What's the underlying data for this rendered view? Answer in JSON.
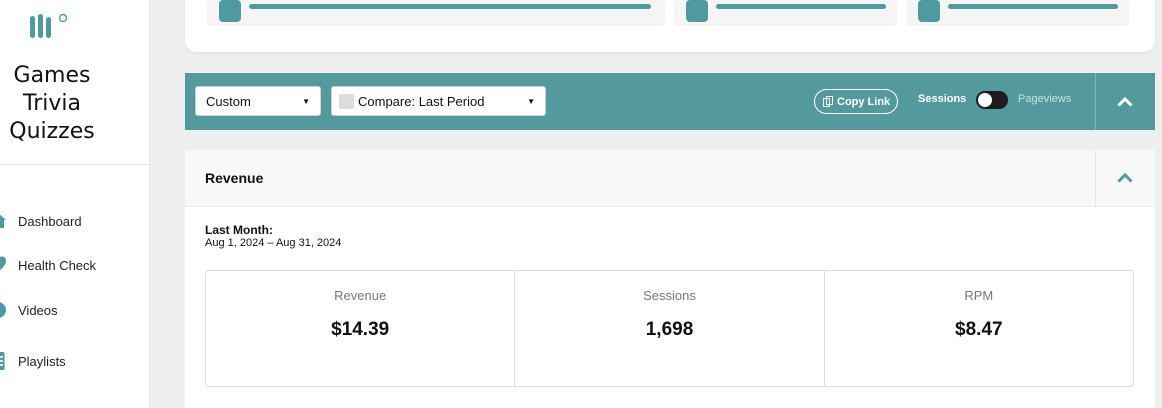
{
  "sidebar": {
    "site_name": "Games Trivia Quizzes",
    "items": [
      {
        "label": "Dashboard",
        "icon": "home-icon"
      },
      {
        "label": "Health Check",
        "icon": "heart-icon"
      },
      {
        "label": "Videos",
        "icon": "video-icon"
      },
      {
        "label": "Playlists",
        "icon": "playlist-icon"
      }
    ]
  },
  "filters": {
    "date_range": "Custom",
    "compare": "Compare: Last Period",
    "copy_link": "Copy Link",
    "toggle_on_label": "Sessions",
    "toggle_off_label": "Pageviews"
  },
  "revenue": {
    "title": "Revenue",
    "period_label": "Last Month:",
    "period_range": "Aug 1, 2024 – Aug 31, 2024",
    "metrics": [
      {
        "label": "Revenue",
        "value": "$14.39"
      },
      {
        "label": "Sessions",
        "value": "1,698"
      },
      {
        "label": "RPM",
        "value": "$8.47"
      }
    ]
  },
  "colors": {
    "accent": "#54999e",
    "sidebar_bg": "#ffffff",
    "page_bg": "#efefef"
  }
}
